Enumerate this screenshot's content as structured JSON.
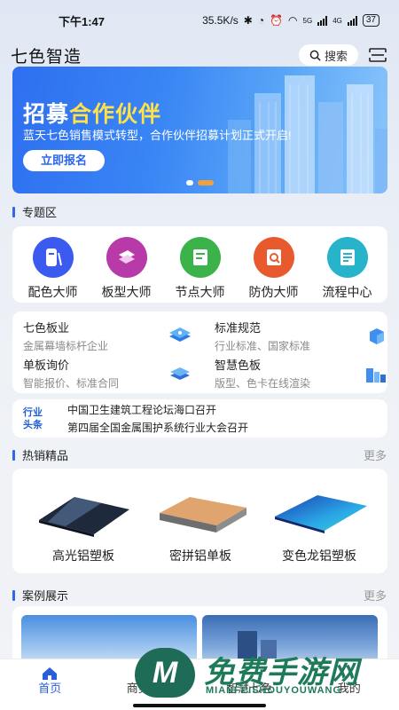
{
  "status": {
    "time": "下午1:47",
    "speed": "35.5K/s",
    "battery": "37",
    "net1": "5G",
    "net2": "4G"
  },
  "header": {
    "title": "七色智造",
    "search_label": "搜索"
  },
  "banner": {
    "title_part1": "招募",
    "title_part2": "合作伙伴",
    "subtitle": "蓝天七色销售模式转型，合作伙伴招募计划正式开启!",
    "button": "立即报名",
    "active_dot": 1
  },
  "special_zone": {
    "title": "专题区",
    "items": [
      {
        "label": "配色大师",
        "icon": "palette-icon",
        "color": "#3b5bf0"
      },
      {
        "label": "板型大师",
        "icon": "board-icon",
        "color": "#b83aa8"
      },
      {
        "label": "节点大师",
        "icon": "node-icon",
        "color": "#3cb24a"
      },
      {
        "label": "防伪大师",
        "icon": "anti-fake-icon",
        "color": "#e85a2e"
      },
      {
        "label": "流程中心",
        "icon": "flow-icon",
        "color": "#27b3c9"
      }
    ]
  },
  "services": [
    {
      "title": "七色板业",
      "sub": "金属幕墙标杆企业",
      "icon": "layers-icon"
    },
    {
      "title": "标准规范",
      "sub": "行业标准、国家标准",
      "icon": "cube-icon"
    },
    {
      "title": "单板询价",
      "sub": "智能报价、标准合同",
      "icon": "stack-icon"
    },
    {
      "title": "智慧色板",
      "sub": "版型、色卡在线渲染",
      "icon": "city-icon"
    }
  ],
  "news": {
    "logo_line1": "行业",
    "logo_line2": "头条",
    "items": [
      "中国卫生建筑工程论坛海口召开",
      "第四届全国金属围护系统行业大会召开"
    ]
  },
  "hot": {
    "title": "热销精品",
    "more": "更多",
    "products": [
      "高光铝塑板",
      "密拼铝单板",
      "变色龙铝塑板"
    ]
  },
  "cases": {
    "title": "案例展示",
    "more": "更多"
  },
  "tabbar": {
    "tabs": [
      "首页",
      "商务中心",
      "智慧七色",
      "我的"
    ]
  },
  "watermark": {
    "letter": "M",
    "big": "免费手游网",
    "small": "MIANFEISHOUYOUWANG"
  },
  "colors": {
    "accent": "#2b5fd9",
    "banner": "#3a86f5",
    "highlight": "#ffe14a"
  }
}
